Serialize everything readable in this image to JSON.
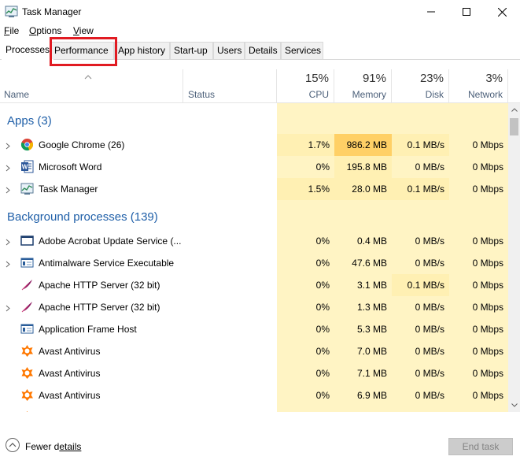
{
  "window": {
    "title": "Task Manager"
  },
  "menu": {
    "file_ul": "F",
    "file_rest": "ile",
    "options_ul": "O",
    "options_rest": "ptions",
    "view_ul": "V",
    "view_rest": "iew"
  },
  "tabs": [
    {
      "label": "Processes"
    },
    {
      "label": "Performance"
    },
    {
      "label": "App history"
    },
    {
      "label": "Start-up"
    },
    {
      "label": "Users"
    },
    {
      "label": "Details"
    },
    {
      "label": "Services"
    }
  ],
  "columns": {
    "name": "Name",
    "status": "Status",
    "cpu": {
      "percent": "15%",
      "label": "CPU"
    },
    "memory": {
      "percent": "91%",
      "label": "Memory"
    },
    "disk": {
      "percent": "23%",
      "label": "Disk"
    },
    "network": {
      "percent": "3%",
      "label": "Network"
    }
  },
  "groups": {
    "apps": "Apps (3)",
    "background": "Background processes (139)"
  },
  "apps": [
    {
      "name": "Google Chrome (26)",
      "cpu": "1.7%",
      "memory": "986.2 MB",
      "disk": "0.1 MB/s",
      "network": "0 Mbps",
      "icon": "chrome-icon"
    },
    {
      "name": "Microsoft Word",
      "cpu": "0%",
      "memory": "195.8 MB",
      "disk": "0 MB/s",
      "network": "0 Mbps",
      "icon": "word-icon"
    },
    {
      "name": "Task Manager",
      "cpu": "1.5%",
      "memory": "28.0 MB",
      "disk": "0.1 MB/s",
      "network": "0 Mbps",
      "icon": "task-manager-icon"
    }
  ],
  "background": [
    {
      "name": "Adobe Acrobat Update Service (...",
      "cpu": "0%",
      "memory": "0.4 MB",
      "disk": "0 MB/s",
      "network": "0 Mbps",
      "icon": "service-window-icon"
    },
    {
      "name": "Antimalware Service Executable",
      "cpu": "0%",
      "memory": "47.6 MB",
      "disk": "0 MB/s",
      "network": "0 Mbps",
      "icon": "service-app-icon"
    },
    {
      "name": "Apache HTTP Server (32 bit)",
      "cpu": "0%",
      "memory": "3.1 MB",
      "disk": "0.1 MB/s",
      "network": "0 Mbps",
      "icon": "apache-feather-icon"
    },
    {
      "name": "Apache HTTP Server (32 bit)",
      "cpu": "0%",
      "memory": "1.3 MB",
      "disk": "0 MB/s",
      "network": "0 Mbps",
      "icon": "apache-feather-icon"
    },
    {
      "name": "Application Frame Host",
      "cpu": "0%",
      "memory": "5.3 MB",
      "disk": "0 MB/s",
      "network": "0 Mbps",
      "icon": "service-app-icon"
    },
    {
      "name": "Avast Antivirus",
      "cpu": "0%",
      "memory": "7.0 MB",
      "disk": "0 MB/s",
      "network": "0 Mbps",
      "icon": "avast-icon"
    },
    {
      "name": "Avast Antivirus",
      "cpu": "0%",
      "memory": "7.1 MB",
      "disk": "0 MB/s",
      "network": "0 Mbps",
      "icon": "avast-icon"
    },
    {
      "name": "Avast Antivirus",
      "cpu": "0%",
      "memory": "6.9 MB",
      "disk": "0 MB/s",
      "network": "0 Mbps",
      "icon": "avast-icon"
    }
  ],
  "footer": {
    "fewer_ul": "Fewer d",
    "fewer_rest_ul": "etails",
    "end_task": "End task"
  },
  "colors": {
    "accent_group": "#1f5fa8",
    "cpu_bg": "#fff4c4",
    "memory_high": "#ffd066",
    "highlight": "#e11b22"
  }
}
